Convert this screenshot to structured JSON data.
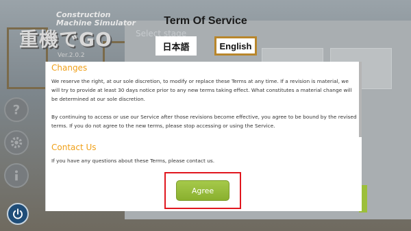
{
  "background": {
    "logo": {
      "subtitle": "Construction\nMachine Simulator",
      "title": "重機でGO",
      "version": "Ver.2.0.2"
    },
    "select_stage_label": "Select stage"
  },
  "dialog": {
    "title": "Term Of Service",
    "languages": [
      {
        "label": "日本語",
        "selected": false
      },
      {
        "label": "English",
        "selected": true
      }
    ],
    "sections": [
      {
        "heading": "Changes",
        "paragraphs": [
          "We reserve the right, at our sole discretion, to modify or replace these Terms at any time. If a revision is material, we will try to provide at least 30 days notice prior to any new terms taking effect. What constitutes a material change will be determined at our sole discretion.",
          "By continuing to access or use our Service after those revisions become effective, you agree to be bound by the revised terms. If you do not agree to the new terms, please stop accessing or using the Service."
        ]
      },
      {
        "heading": "Contact Us",
        "paragraphs": [
          "If you have any questions about these Terms, please contact us."
        ]
      }
    ],
    "agree_label": "Agree"
  },
  "colors": {
    "section_heading": "#f0a018",
    "agree_button": "#9bbd3c",
    "highlight": "#e0161e",
    "selected_language_border": "#b8862b"
  },
  "icons": {
    "side_buttons": [
      "help-icon",
      "settings-icon",
      "info-icon"
    ],
    "power": "power-icon"
  }
}
